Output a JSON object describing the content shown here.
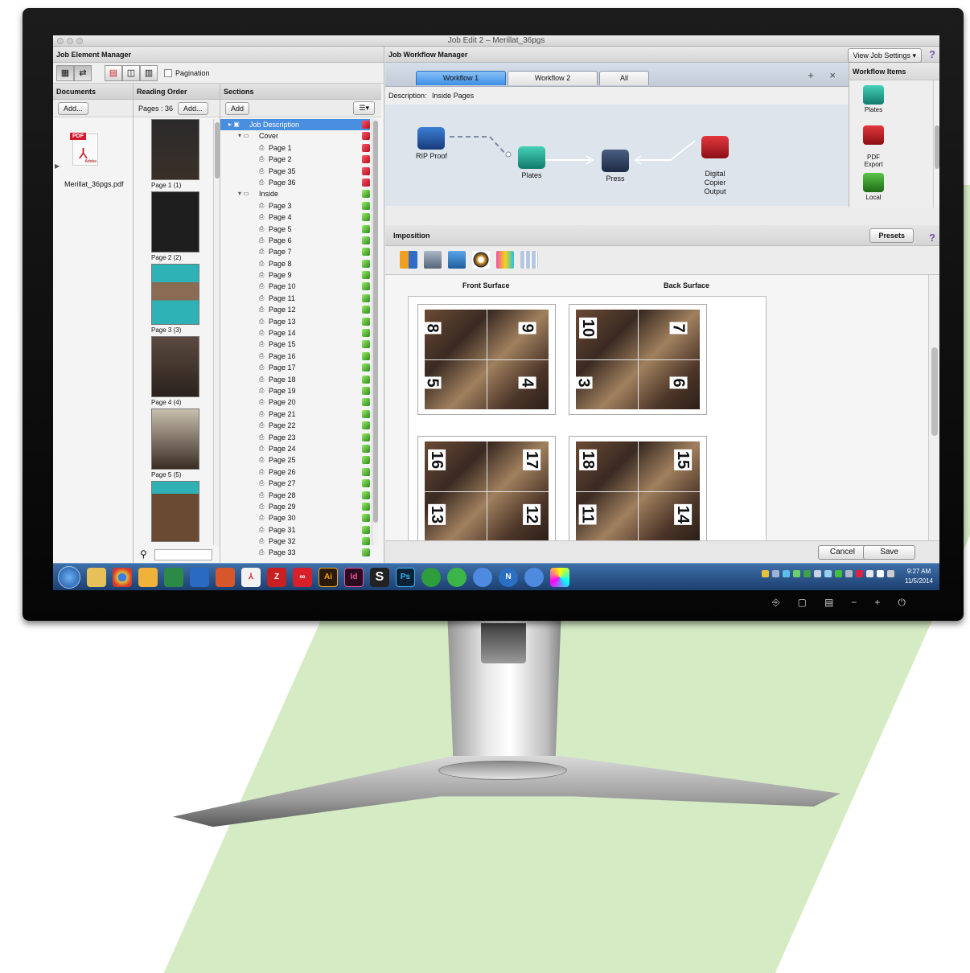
{
  "window": {
    "title": "Job Edit 2 – Merillat_36pgs"
  },
  "left_panel": {
    "title": "Job Element Manager",
    "pagination_label": "Pagination",
    "documents": {
      "title": "Documents",
      "add_label": "Add...",
      "file_name": "Merillat_36pgs.pdf",
      "pdf_tag": "PDF",
      "adobe_text": "Adobe"
    },
    "reading_order": {
      "title": "Reading Order",
      "pages_count": "Pages : 36",
      "add_label": "Add...",
      "thumbs": [
        "Page 1 (1)",
        "Page 2 (2)",
        "Page 3 (3)",
        "Page 4 (4)",
        "Page 5 (5)"
      ]
    },
    "sections": {
      "title": "Sections",
      "add_label": "Add",
      "rows": [
        "Job Description",
        "Cover",
        "Page 1",
        "Page 2",
        "Page 35",
        "Page 36",
        "Inside",
        "Page 3",
        "Page 4",
        "Page 5",
        "Page 6",
        "Page 7",
        "Page 8",
        "Page 9",
        "Page 10",
        "Page 11",
        "Page 12",
        "Page 13",
        "Page 14",
        "Page 15",
        "Page 16",
        "Page 17",
        "Page 18",
        "Page 19",
        "Page 20",
        "Page 21",
        "Page 22",
        "Page 23",
        "Page 24",
        "Page 25",
        "Page 26",
        "Page 27",
        "Page 28",
        "Page 29",
        "Page 30",
        "Page 31",
        "Page 32",
        "Page 33"
      ]
    }
  },
  "right_panel": {
    "title": "Job Workflow Manager",
    "view_job_settings": "View Job Settings",
    "help": "?",
    "tabs": [
      "Workflow 1",
      "Workflow 2",
      "All"
    ],
    "tab_add": "+",
    "tab_close": "×",
    "description_label": "Description:",
    "description_value": "Inside Pages",
    "nodes": {
      "rip": "RIP Proof",
      "plates": "Plates",
      "press": "Press",
      "digital": "Digital\nCopier\nOutput"
    },
    "workflow_items": {
      "title": "Workflow Items",
      "items": [
        "Plates",
        "PDF\nExport",
        "Local"
      ]
    },
    "imposition": {
      "title": "Imposition",
      "presets": "Presets",
      "front": "Front Surface",
      "back": "Back Surface"
    },
    "signatures": [
      {
        "nums": [
          "8",
          "9",
          "5",
          "4"
        ]
      },
      {
        "nums": [
          "10",
          "7",
          "3",
          "6"
        ]
      },
      {
        "nums": [
          "16",
          "17",
          "13",
          "12"
        ]
      },
      {
        "nums": [
          "18",
          "15",
          "11",
          "14"
        ]
      }
    ],
    "cancel": "Cancel",
    "save": "Save"
  },
  "taskbar": {
    "time": "9:27 AM",
    "date": "11/5/2014",
    "apps": [
      "Ai",
      "Id",
      "Ps"
    ]
  },
  "colors": {
    "accent": "#3c8ee6",
    "selection": "#4a8ee0",
    "taskbar": "#1c3f70",
    "stripe": "#d4ebc4"
  }
}
